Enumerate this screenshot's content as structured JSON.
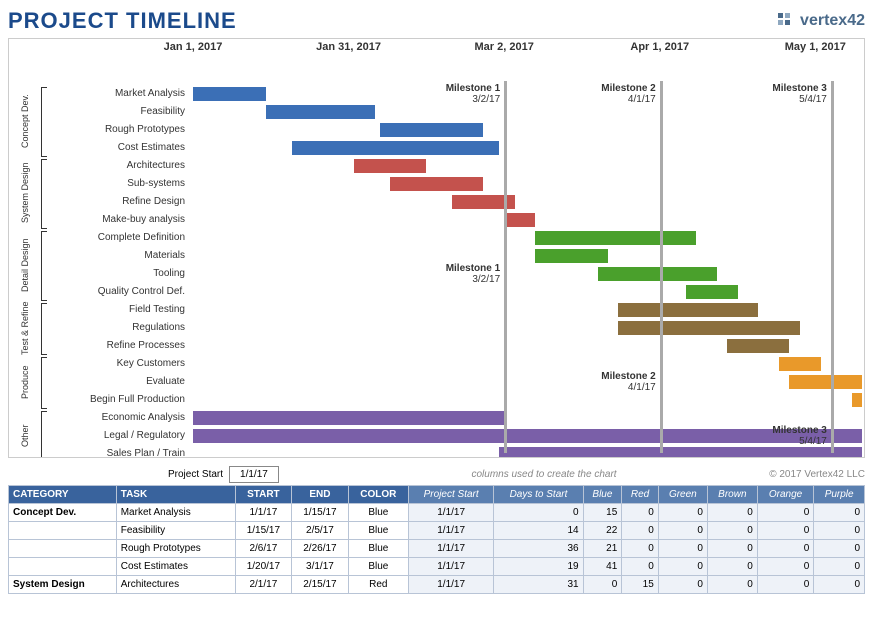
{
  "title": "PROJECT TIMELINE",
  "logo_text": "vertex42",
  "chart_data": {
    "type": "gantt",
    "title": "Project Timeline",
    "x_type": "date",
    "x_range": [
      "2017-01-01",
      "2017-05-10"
    ],
    "time_axis": [
      {
        "label": "Jan 1, 2017",
        "date": "2017-01-01"
      },
      {
        "label": "Jan 31, 2017",
        "date": "2017-01-31"
      },
      {
        "label": "Mar 2, 2017",
        "date": "2017-03-02"
      },
      {
        "label": "Apr 1, 2017",
        "date": "2017-04-01"
      },
      {
        "label": "May 1, 2017",
        "date": "2017-05-01"
      }
    ],
    "milestones": [
      {
        "name": "Milestone 1",
        "label": "3/2/17",
        "date": "2017-03-02",
        "label_rows": [
          0,
          10
        ]
      },
      {
        "name": "Milestone 2",
        "label": "4/1/17",
        "date": "2017-04-01",
        "label_rows": [
          0,
          16
        ]
      },
      {
        "name": "Milestone 3",
        "label": "5/4/17",
        "date": "2017-05-04",
        "label_rows": [
          0,
          19
        ]
      }
    ],
    "categories": [
      {
        "name": "Concept Dev.",
        "short": "Concept\nDev.",
        "tasks": [
          {
            "name": "Market Analysis",
            "start": "2017-01-01",
            "end": "2017-01-15",
            "color": "Blue"
          },
          {
            "name": "Feasibility",
            "start": "2017-01-15",
            "end": "2017-02-05",
            "color": "Blue"
          },
          {
            "name": "Rough Prototypes",
            "start": "2017-02-06",
            "end": "2017-02-26",
            "color": "Blue"
          },
          {
            "name": "Cost Estimates",
            "start": "2017-01-20",
            "end": "2017-03-01",
            "color": "Blue"
          }
        ]
      },
      {
        "name": "System Design",
        "short": "System\nDesign",
        "tasks": [
          {
            "name": "Architectures",
            "start": "2017-02-01",
            "end": "2017-02-15",
            "color": "Red"
          },
          {
            "name": "Sub-systems",
            "start": "2017-02-08",
            "end": "2017-02-26",
            "color": "Red"
          },
          {
            "name": "Refine Design",
            "start": "2017-02-20",
            "end": "2017-03-04",
            "color": "Red"
          },
          {
            "name": "Make-buy analysis",
            "start": "2017-03-02",
            "end": "2017-03-08",
            "color": "Red"
          }
        ]
      },
      {
        "name": "Detail Design",
        "short": "Detail\nDesign",
        "tasks": [
          {
            "name": "Complete Definition",
            "start": "2017-03-08",
            "end": "2017-04-08",
            "color": "Green"
          },
          {
            "name": "Materials",
            "start": "2017-03-08",
            "end": "2017-03-22",
            "color": "Green"
          },
          {
            "name": "Tooling",
            "start": "2017-03-20",
            "end": "2017-04-12",
            "color": "Green"
          },
          {
            "name": "Quality Control Def.",
            "start": "2017-04-06",
            "end": "2017-04-16",
            "color": "Green"
          }
        ]
      },
      {
        "name": "Test & Refine",
        "short": "Test &\nRefine",
        "tasks": [
          {
            "name": "Field Testing",
            "start": "2017-03-24",
            "end": "2017-04-20",
            "color": "Brown"
          },
          {
            "name": "Regulations",
            "start": "2017-03-24",
            "end": "2017-04-28",
            "color": "Brown"
          },
          {
            "name": "Refine Processes",
            "start": "2017-04-14",
            "end": "2017-04-26",
            "color": "Brown"
          }
        ]
      },
      {
        "name": "Produce",
        "short": "Produce",
        "tasks": [
          {
            "name": "Key Customers",
            "start": "2017-04-24",
            "end": "2017-05-02",
            "color": "Orange"
          },
          {
            "name": "Evaluate",
            "start": "2017-04-26",
            "end": "2017-05-10",
            "color": "Orange"
          },
          {
            "name": "Begin Full Production",
            "start": "2017-05-08",
            "end": "2017-05-10",
            "color": "Orange"
          }
        ]
      },
      {
        "name": "Other",
        "short": "Other",
        "tasks": [
          {
            "name": "Economic Analysis",
            "start": "2017-01-01",
            "end": "2017-03-02",
            "color": "Purple"
          },
          {
            "name": "Legal / Regulatory",
            "start": "2017-01-01",
            "end": "2017-05-10",
            "color": "Purple"
          },
          {
            "name": "Sales Plan / Train",
            "start": "2017-03-01",
            "end": "2017-05-10",
            "color": "Purple"
          }
        ]
      }
    ],
    "color_map": {
      "Blue": "#3b6fb6",
      "Red": "#c4524d",
      "Green": "#4aa02c",
      "Brown": "#8b6f3e",
      "Orange": "#e9992a",
      "Purple": "#7a5fa8"
    }
  },
  "meta": {
    "project_start_label": "Project Start",
    "project_start_value": "1/1/17",
    "columns_note": "columns used to create the chart",
    "copyright": "© 2017 Vertex42 LLC"
  },
  "table": {
    "headers": [
      "CATEGORY",
      "TASK",
      "START",
      "END",
      "COLOR"
    ],
    "calc_headers": [
      "Project Start",
      "Days to Start",
      "Blue",
      "Red",
      "Green",
      "Brown",
      "Orange",
      "Purple"
    ],
    "rows": [
      {
        "category": "Concept Dev.",
        "task": "Market Analysis",
        "start": "1/1/17",
        "end": "1/15/17",
        "color": "Blue",
        "ps": "1/1/17",
        "dts": 0,
        "blue": 15,
        "red": 0,
        "green": 0,
        "brown": 0,
        "orange": 0,
        "purple": 0
      },
      {
        "category": "",
        "task": "Feasibility",
        "start": "1/15/17",
        "end": "2/5/17",
        "color": "Blue",
        "ps": "1/1/17",
        "dts": 14,
        "blue": 22,
        "red": 0,
        "green": 0,
        "brown": 0,
        "orange": 0,
        "purple": 0
      },
      {
        "category": "",
        "task": "Rough Prototypes",
        "start": "2/6/17",
        "end": "2/26/17",
        "color": "Blue",
        "ps": "1/1/17",
        "dts": 36,
        "blue": 21,
        "red": 0,
        "green": 0,
        "brown": 0,
        "orange": 0,
        "purple": 0
      },
      {
        "category": "",
        "task": "Cost Estimates",
        "start": "1/20/17",
        "end": "3/1/17",
        "color": "Blue",
        "ps": "1/1/17",
        "dts": 19,
        "blue": 41,
        "red": 0,
        "green": 0,
        "brown": 0,
        "orange": 0,
        "purple": 0
      },
      {
        "category": "System Design",
        "task": "Architectures",
        "start": "2/1/17",
        "end": "2/15/17",
        "color": "Red",
        "ps": "1/1/17",
        "dts": 31,
        "blue": 0,
        "red": 15,
        "green": 0,
        "brown": 0,
        "orange": 0,
        "purple": 0
      }
    ]
  }
}
